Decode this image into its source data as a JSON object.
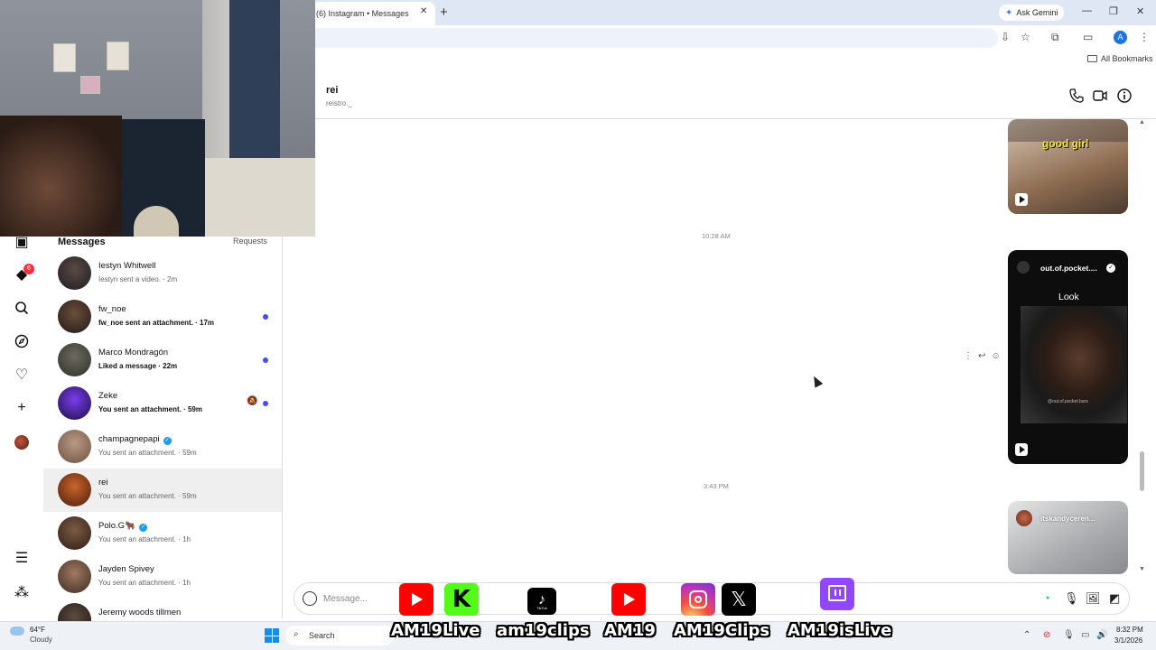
{
  "browser": {
    "tab_title": "(6) Instagram • Messages",
    "tab_close": "✕",
    "new_tab": "+",
    "gemini_label": "Ask Gemini",
    "bookmarks_label": "All Bookmarks",
    "profile_initial": "A"
  },
  "sidebar": {
    "notification_count": "6"
  },
  "messages": {
    "title": "Messages",
    "requests": "Requests",
    "threads": [
      {
        "name": "Iestyn Whitwell",
        "preview": "Iestyn sent a video. · 2m",
        "unread": false,
        "muted": false,
        "verified": false
      },
      {
        "name": "fw_noe",
        "preview": "fw_noe sent an attachment. · 17m",
        "unread": true,
        "muted": false,
        "verified": false
      },
      {
        "name": "Marco Mondragón",
        "preview": "Liked a message · 22m",
        "unread": true,
        "muted": false,
        "verified": false
      },
      {
        "name": "Zeke",
        "preview": "You sent an attachment. · 59m",
        "unread": true,
        "muted": true,
        "verified": false
      },
      {
        "name": "champagnepapi",
        "preview": "You sent an attachment. · 59m",
        "unread": false,
        "muted": false,
        "verified": true
      },
      {
        "name": "rei",
        "preview": "You sent an attachment. · 59m",
        "unread": false,
        "muted": false,
        "verified": false,
        "active": true
      },
      {
        "name": "Polo.G🐂",
        "preview": "You sent an attachment. · 1h",
        "unread": false,
        "muted": false,
        "verified": true
      },
      {
        "name": "Jayden Spivey",
        "preview": "You sent an attachment. · 1h",
        "unread": false,
        "muted": false,
        "verified": false
      },
      {
        "name": "Jeremy woods tillmen",
        "preview": "",
        "unread": false,
        "muted": false,
        "verified": false
      }
    ]
  },
  "chat": {
    "name": "rei",
    "username": "reistro._",
    "timestamps": [
      "10:28 AM",
      "3:43 PM"
    ],
    "media": [
      {
        "caption": "good girl"
      },
      {
        "account": "out.of.pocket....",
        "caption": "Look",
        "watermark": "@out.of.pocket.bars"
      },
      {
        "account": "itskandyceren..."
      }
    ],
    "composer_placeholder": "Message..."
  },
  "stream_overlay": {
    "labels": [
      "AM19Live",
      "am19clips",
      "AM19",
      "AM19Clips",
      "AM19isLive"
    ],
    "tiktok_text": "TikTok"
  },
  "taskbar": {
    "temperature": "64°F",
    "weather": "Cloudy",
    "search_label": "Search",
    "time": "8:32 PM",
    "date": "3/1/2026"
  },
  "colors": {
    "accent": "#4150f7",
    "notification": "#ff3040",
    "verified": "#1d9bf0"
  }
}
